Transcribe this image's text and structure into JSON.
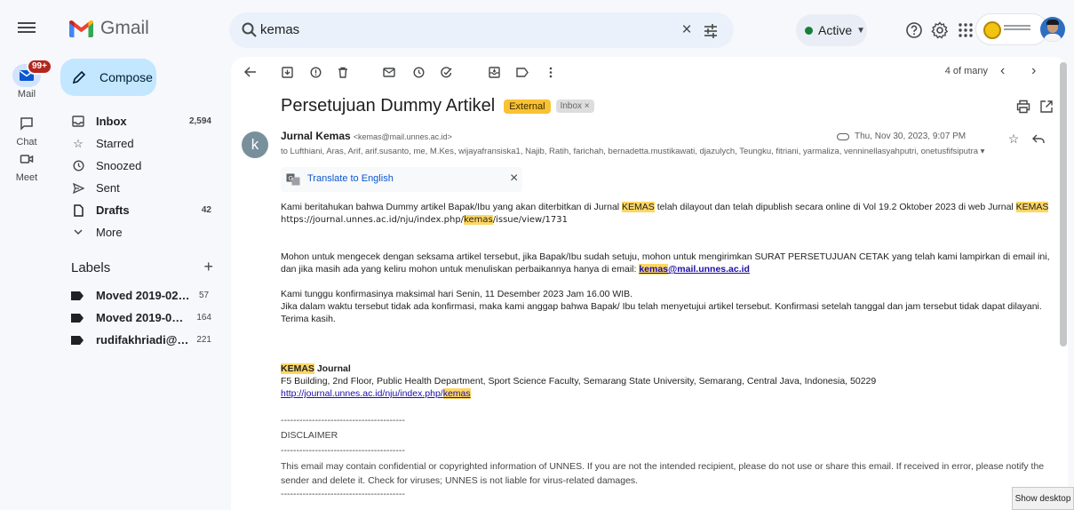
{
  "app": {
    "name": "Gmail"
  },
  "search": {
    "value": "kemas"
  },
  "status": {
    "label": "Active"
  },
  "rail": [
    {
      "label": "Mail",
      "badge": "99+"
    },
    {
      "label": "Chat"
    },
    {
      "label": "Meet"
    }
  ],
  "compose": {
    "label": "Compose"
  },
  "nav": [
    {
      "label": "Inbox",
      "count": "2,594",
      "icon": "inbox-icon"
    },
    {
      "label": "Starred",
      "count": "",
      "icon": "star-icon"
    },
    {
      "label": "Snoozed",
      "count": "",
      "icon": "clock-icon"
    },
    {
      "label": "Sent",
      "count": "",
      "icon": "send-icon"
    },
    {
      "label": "Drafts",
      "count": "42",
      "icon": "draft-icon"
    },
    {
      "label": "More",
      "count": "",
      "icon": "chevron-down-icon"
    }
  ],
  "labels": {
    "heading": "Labels",
    "items": [
      {
        "name": "Moved 2019-02-13...",
        "count": "57"
      },
      {
        "name": "Moved 2019-02-1...",
        "count": "164"
      },
      {
        "name": "rudifakhriadi@unl...",
        "count": "221"
      }
    ]
  },
  "pager": {
    "text": "4 of many"
  },
  "email": {
    "subject": "Persetujuan Dummy Artikel",
    "tag_external": "External",
    "tag_inbox": "Inbox ×",
    "sender_initial": "k",
    "sender_name": "Jurnal Kemas",
    "sender_email": "<kemas@mail.unnes.ac.id>",
    "recipients": "to Lufthiani, Aras, Arif, arif.susanto, me, M.Kes, wijayafransiska1, Najib, Ratih, farichah, bernadetta.mustikawati, djazulych, Teungku, fitriani, yarmaliza, venninellasyahputri, onetusfifsiputra ▾",
    "date": "Thu, Nov 30, 2023, 9:07 PM",
    "translate_label": "Translate to English",
    "body": {
      "p1_a": "Kami beritahukan bahwa Dummy artikel Bapak/Ibu yang akan diterbitkan di Jurnal ",
      "p1_hl": "KEMAS",
      "p1_b": " telah dilayout dan telah dipublish secara online di Vol 19.2 Oktober 2023 di web Jurnal ",
      "p1_hl2": "KEMAS",
      "p1_url_a": "https://journal.unnes.ac.id/nju/index.php/",
      "p1_url_hl": "kemas",
      "p1_url_b": "/issue/view/1731",
      "p2_a": "Mohon untuk mengecek dengan seksama artikel tersebut, jika Bapak/Ibu sudah setuju, mohon untuk mengirimkan SURAT PERSETUJUAN CETAK yang telah kami lampirkan di email ini, dan jika masih ada yang keliru mohon untuk menuliskan perbaikannya hanya di email: ",
      "p2_email_hl": "kemas",
      "p2_email_b": "@mail.unnes.ac.id",
      "p3_l1": "Kami tunggu konfirmasinya maksimal hari Senin, 11 Desember 2023 Jam 16.00 WIB.",
      "p3_l2": "Jika dalam waktu tersebut tidak ada konfirmasi, maka kami anggap bahwa Bapak/ Ibu telah menyetujui artikel tersebut. Konfirmasi setelah tanggal dan jam tersebut tidak dapat dilayani.",
      "p3_l3": "Terima kasih.",
      "sig_hl": "KEMAS",
      "sig_b": " Journal",
      "sig_addr": "F5 Building, 2nd Floor, Public Health Department, Sport Science Faculty, Semarang State University, Semarang, Central Java, Indonesia, 50229",
      "sig_url_a": "http://journal.unnes.ac.id/nju/index.php/",
      "sig_url_hl": "kemas",
      "dash": "----------------------------------------",
      "disclaimer_h": "DISCLAIMER",
      "disclaimer": "This email may contain confidential or copyrighted information of UNNES. If you are not the intended recipient, please do not use or share this email. If received in error, please notify the sender and delete it. Check for viruses; UNNES is not liable for virus-related damages."
    }
  },
  "taskbar": {
    "show_desktop": "Show desktop"
  },
  "colors": {
    "accent": "#0b57d0",
    "compose_bg": "#c2e7ff",
    "highlight": "#fdd663",
    "external_tag": "#f9c232"
  }
}
